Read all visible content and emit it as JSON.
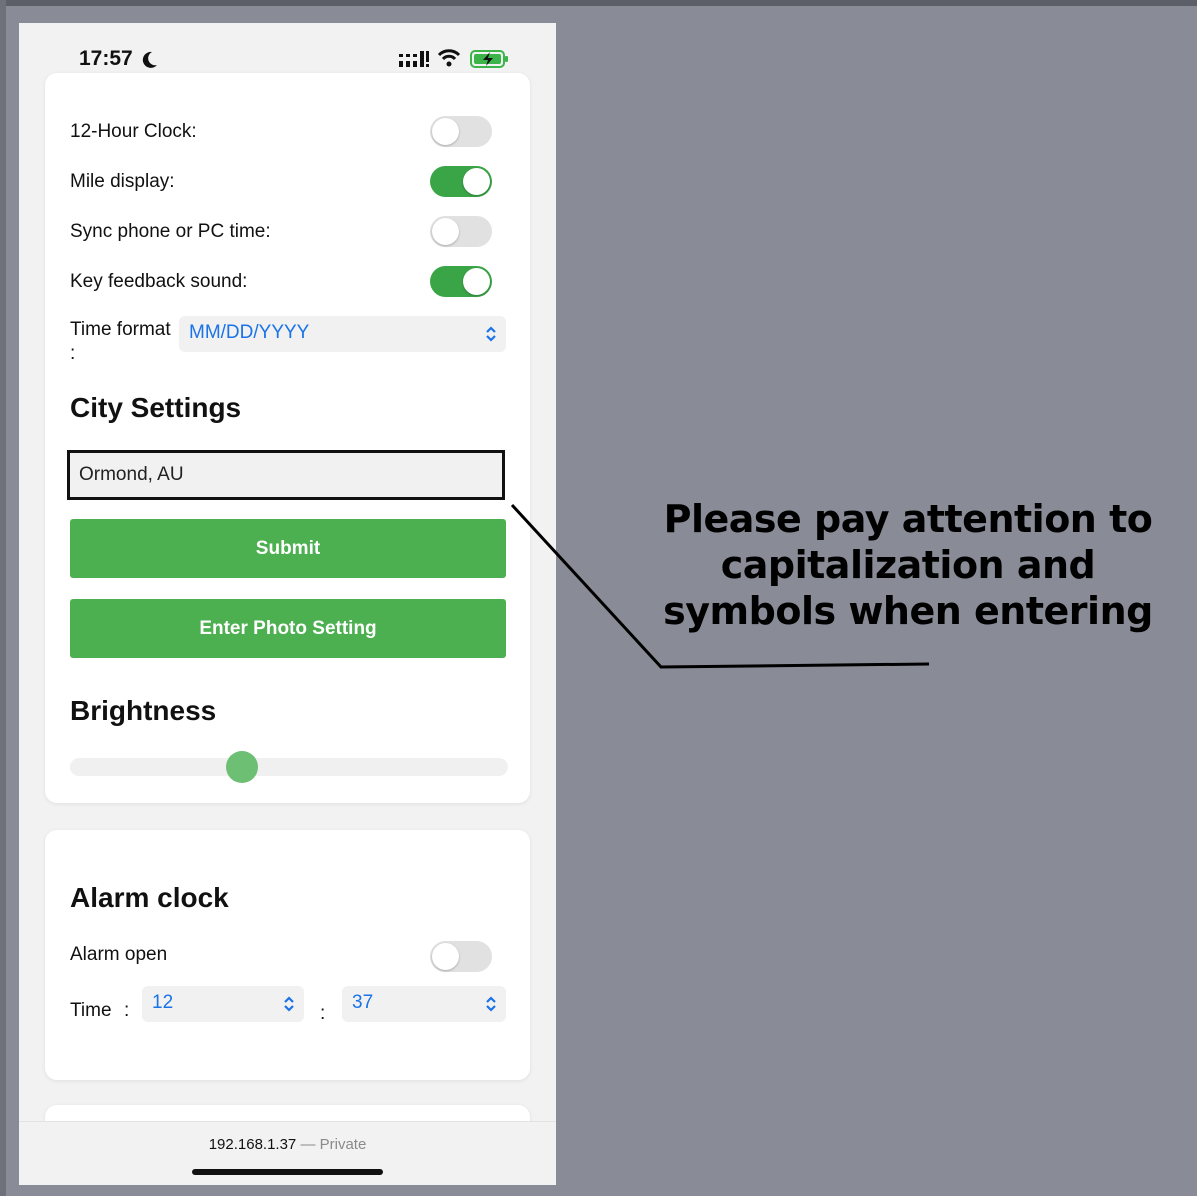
{
  "status_bar": {
    "time": "17:57"
  },
  "settings": {
    "toggles": [
      {
        "label": "12-Hour Clock:",
        "on": false
      },
      {
        "label": "Mile display:",
        "on": true
      },
      {
        "label": "Sync phone or PC time:",
        "on": false
      },
      {
        "label": "Key feedback sound:",
        "on": true
      }
    ],
    "time_format_label_line1": "Time format",
    "time_format_label_line2": ":",
    "time_format_value": "MM/DD/YYYY"
  },
  "city": {
    "heading": "City Settings",
    "input_value": "Ormond, AU",
    "submit_label": "Submit",
    "photo_label": "Enter Photo Setting"
  },
  "brightness": {
    "heading": "Brightness",
    "level": 0.39
  },
  "alarm": {
    "heading": "Alarm clock",
    "open_label": "Alarm open",
    "open_on": false,
    "time_label": "Time",
    "colon": ":",
    "hour": "12",
    "minute": "37"
  },
  "browser": {
    "url": "192.168.1.37",
    "separator": "—",
    "mode": "Private"
  },
  "annotation": {
    "line1": "Please pay attention to",
    "line2": "capitalization and",
    "line3": "symbols when entering"
  }
}
